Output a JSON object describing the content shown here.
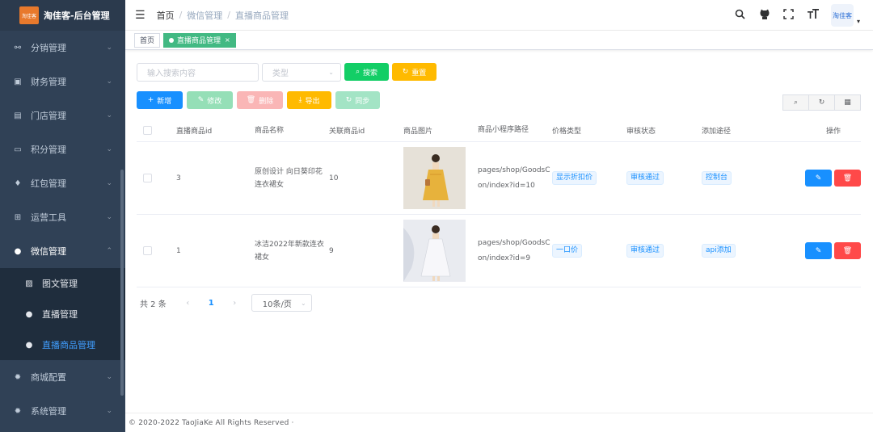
{
  "app": {
    "title": "淘佳客-后台管理",
    "logo_text": "淘佳客"
  },
  "sidebar": {
    "items": [
      {
        "label": "分销管理",
        "icon": "share-icon"
      },
      {
        "label": "财务管理",
        "icon": "money-icon"
      },
      {
        "label": "门店管理",
        "icon": "store-icon"
      },
      {
        "label": "积分管理",
        "icon": "points-icon"
      },
      {
        "label": "红包管理",
        "icon": "redpacket-icon"
      },
      {
        "label": "运营工具",
        "icon": "tools-icon"
      },
      {
        "label": "微信管理",
        "icon": "wechat-icon"
      },
      {
        "label": "商城配置",
        "icon": "gear-icon"
      },
      {
        "label": "系统管理",
        "icon": "gear-icon"
      }
    ],
    "wechat_sub": [
      {
        "label": "图文管理",
        "icon": "image-text-icon"
      },
      {
        "label": "直播管理",
        "icon": "wechat-icon"
      },
      {
        "label": "直播商品管理",
        "icon": "wechat-icon"
      }
    ]
  },
  "header": {
    "breadcrumb": [
      "首页",
      "微信管理",
      "直播商品管理"
    ],
    "avatar_text": "淘佳客"
  },
  "tags": {
    "home": "首页",
    "active": "直播商品管理"
  },
  "search": {
    "keyword_placeholder": "输入搜索内容",
    "type_placeholder": "类型",
    "search_label": "搜索",
    "reset_label": "重置"
  },
  "actions": {
    "add": "新增",
    "edit": "修改",
    "delete": "删除",
    "export": "导出",
    "sync": "同步"
  },
  "table": {
    "headers": [
      "直播商品id",
      "商品名称",
      "关联商品id",
      "商品图片",
      "商品小程序路径",
      "价格类型",
      "审核状态",
      "添加途径",
      "操作"
    ],
    "rows": [
      {
        "id": "3",
        "name": "原创设计 向日葵印花连衣裙女",
        "product_id": "10",
        "path": "pages/shop/GoodsCon/index?id=10",
        "price_type": "显示折扣价",
        "status": "审核通过",
        "via": "控制台"
      },
      {
        "id": "1",
        "name": "冰洁2022年新款连衣裙女",
        "product_id": "9",
        "path": "pages/shop/GoodsCon/index?id=9",
        "price_type": "一口价",
        "status": "审核通过",
        "via": "api添加"
      }
    ]
  },
  "pagination": {
    "total": "共 2 条",
    "current": "1",
    "page_size": "10条/页"
  },
  "footer": {
    "copyright": "© 2020-2022 TaoJiaKe All Rights Reserved ·"
  },
  "colors": {
    "sidebar_bg": "#304156",
    "active_tag": "#42b983",
    "primary": "#1890ff",
    "success": "#13ce66",
    "warning": "#ffba00",
    "danger": "#ff4949"
  }
}
